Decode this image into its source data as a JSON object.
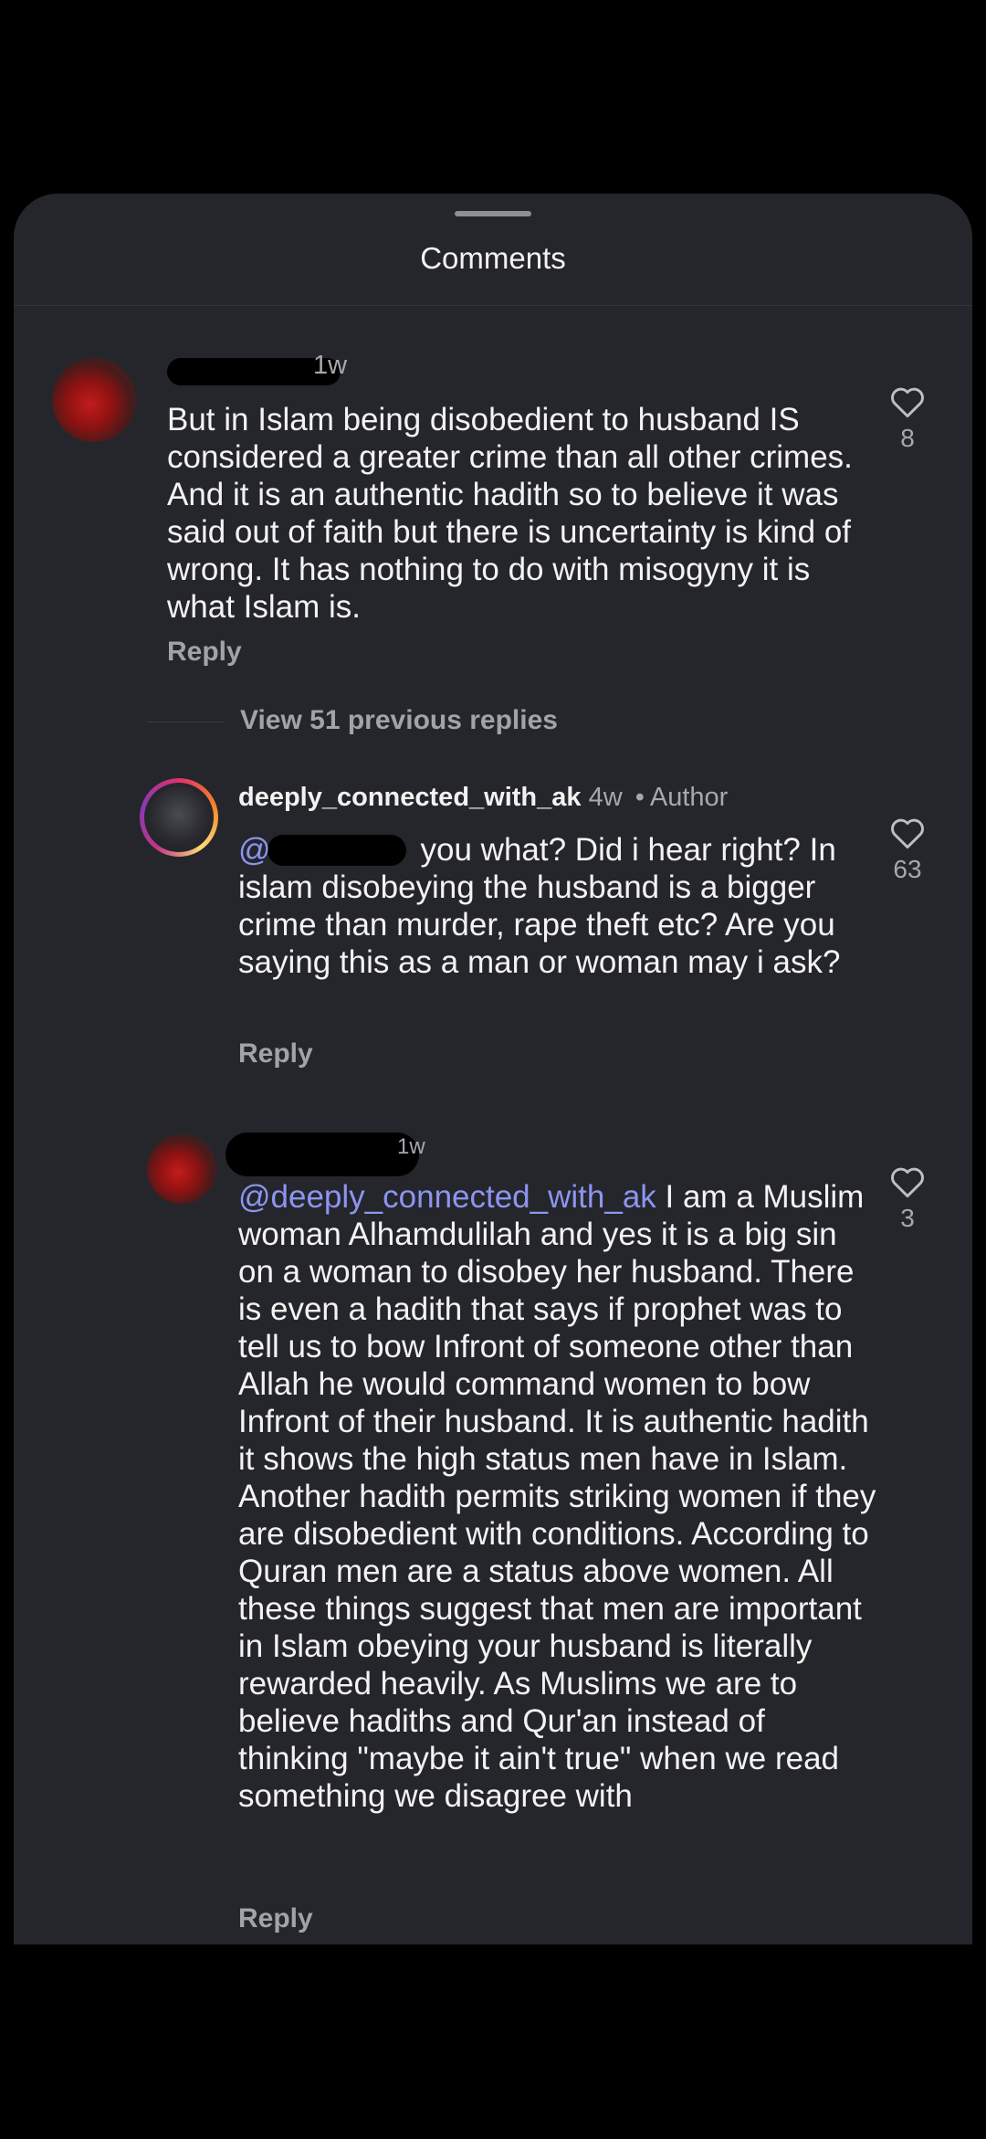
{
  "sheet": {
    "title": "Comments"
  },
  "comments": [
    {
      "time": "1w",
      "text": "But in Islam being disobedient to husband IS considered a greater crime than all other crimes. And it is an authentic hadith so to believe it was said out of faith but there is uncertainty is kind of wrong. It has nothing to do with misogyny it is what Islam is.",
      "reply_label": "Reply",
      "likes": "8"
    }
  ],
  "view_replies": "View 51 previous replies",
  "replies": [
    {
      "username": "deeply_connected_with_ak",
      "time": "4w",
      "separator": "•",
      "badge": "Author",
      "mention_prefix": "@",
      "text": "you what? Did i hear right? In islam disobeying the husband is a bigger crime than murder, rape theft etc? Are you saying this as a man or woman may i ask?",
      "reply_label": "Reply",
      "likes": "63"
    },
    {
      "time": "1w",
      "mention": "@deeply_connected_with_ak",
      "text": " I am a Muslim woman Alhamdulilah and yes it is a big sin on a woman to disobey her husband. There is even a hadith that says if prophet was to tell us to bow Infront of someone other than Allah he would command women to bow Infront of their husband. It is authentic hadith it shows the high status men have in Islam. Another hadith permits striking women if they are disobedient with conditions. According to Quran men are a status above women. All these things suggest that men are important in Islam obeying your husband is literally rewarded heavily. As Muslims we are to believe hadiths and Qur'an instead of thinking \"maybe it ain't true\" when we read something we disagree with",
      "reply_label": "Reply",
      "likes": "3"
    }
  ],
  "colors": {
    "sheet_bg": "#25262b",
    "mention": "#8c95f0",
    "secondary_text": "#a7a8ad"
  }
}
